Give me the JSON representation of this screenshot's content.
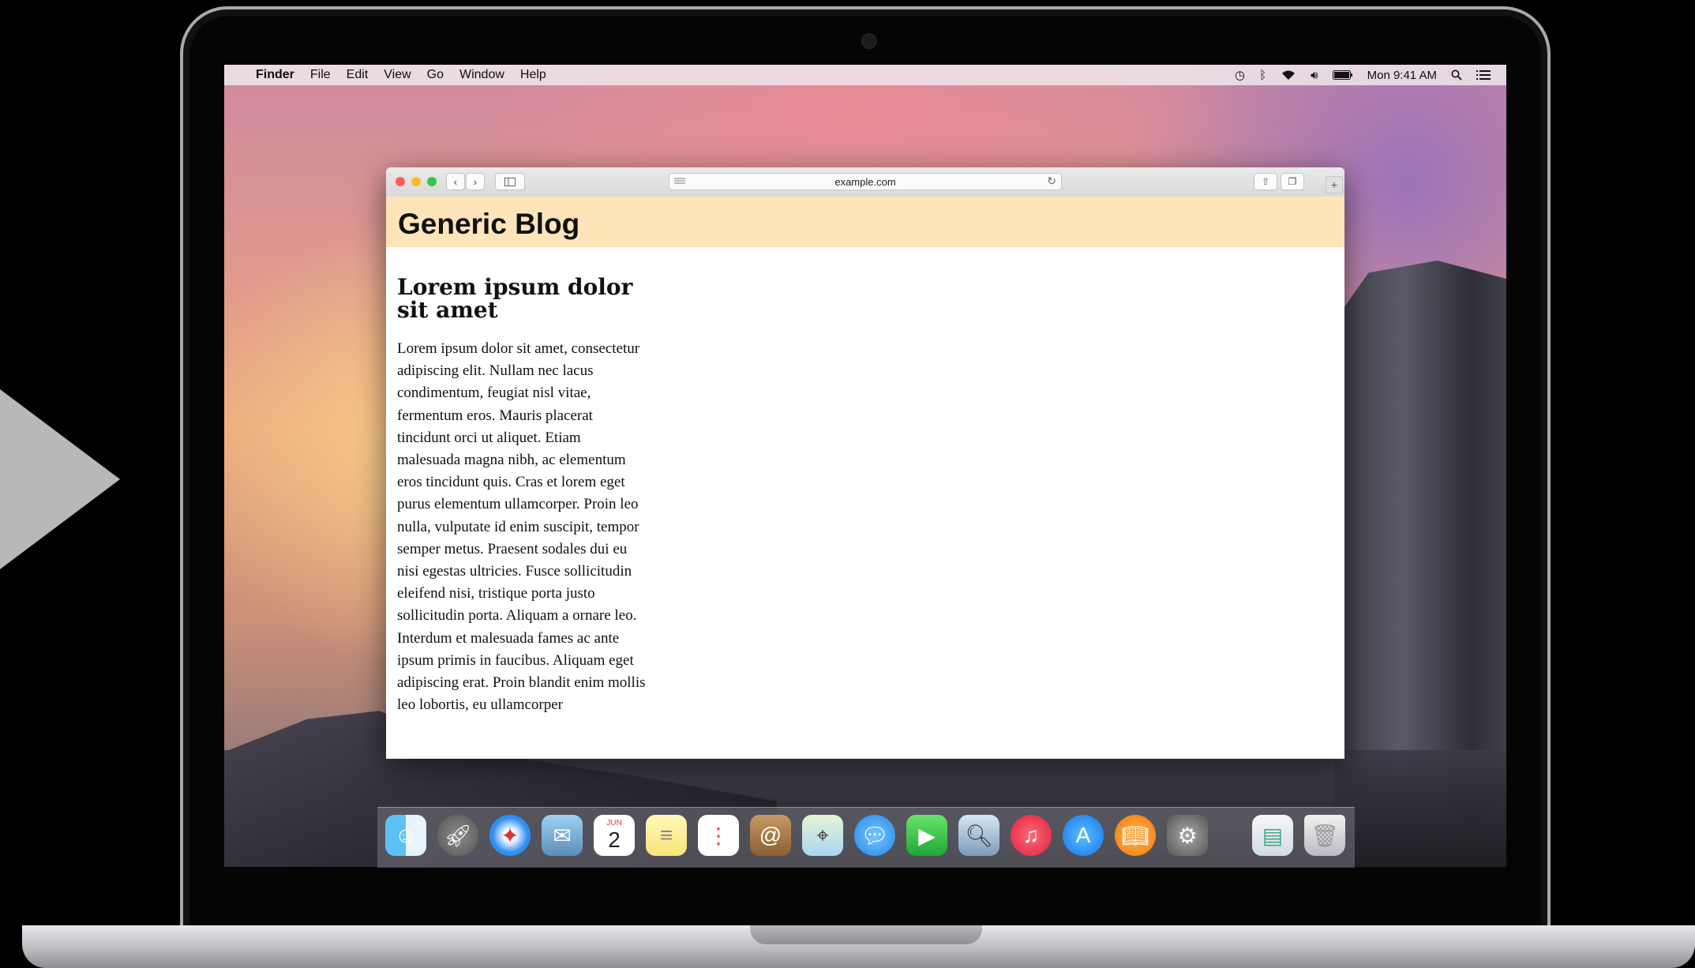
{
  "menubar": {
    "app": "Finder",
    "items": [
      "File",
      "Edit",
      "View",
      "Go",
      "Window",
      "Help"
    ],
    "clock": "Mon 9:41 AM"
  },
  "browser": {
    "url": "example.com"
  },
  "blog": {
    "title": "Generic Blog",
    "article_heading": "Lorem ipsum dolor sit amet",
    "article_body": "Lorem ipsum dolor sit amet, consectetur adipiscing elit. Nullam nec lacus condimentum, feugiat nisl vitae, fermentum eros. Mauris placerat tincidunt orci ut aliquet. Etiam malesuada magna nibh, ac elementum eros tincidunt quis. Cras et lorem eget purus elementum ullamcorper. Proin leo nulla, vulputate id enim suscipit, tempor semper metus. Praesent sodales dui eu nisi egestas ultricies. Fusce sollicitudin eleifend nisi, tristique porta justo sollicitudin porta. Aliquam a ornare leo. Interdum et malesuada fames ac ante ipsum primis in faucibus. Aliquam eget adipiscing erat. Proin blandit enim mollis leo lobortis, eu ullamcorper"
  },
  "dock": {
    "calendar_month": "JUN",
    "calendar_day": "2",
    "apps": [
      "finder-icon",
      "launchpad-icon",
      "safari-icon",
      "mail-icon",
      "calendar-icon",
      "notes-icon",
      "reminders-icon",
      "contacts-icon",
      "maps-icon",
      "messages-icon",
      "facetime-icon",
      "preview-icon",
      "itunes-icon",
      "app-store-icon",
      "ibooks-icon",
      "system-preferences-icon",
      "documents-icon",
      "trash-icon"
    ]
  },
  "colors": {
    "blog_header_bg": "#fde5b9",
    "close": "#fc5f57",
    "minimize": "#fdbc2e",
    "zoom": "#33c748"
  }
}
